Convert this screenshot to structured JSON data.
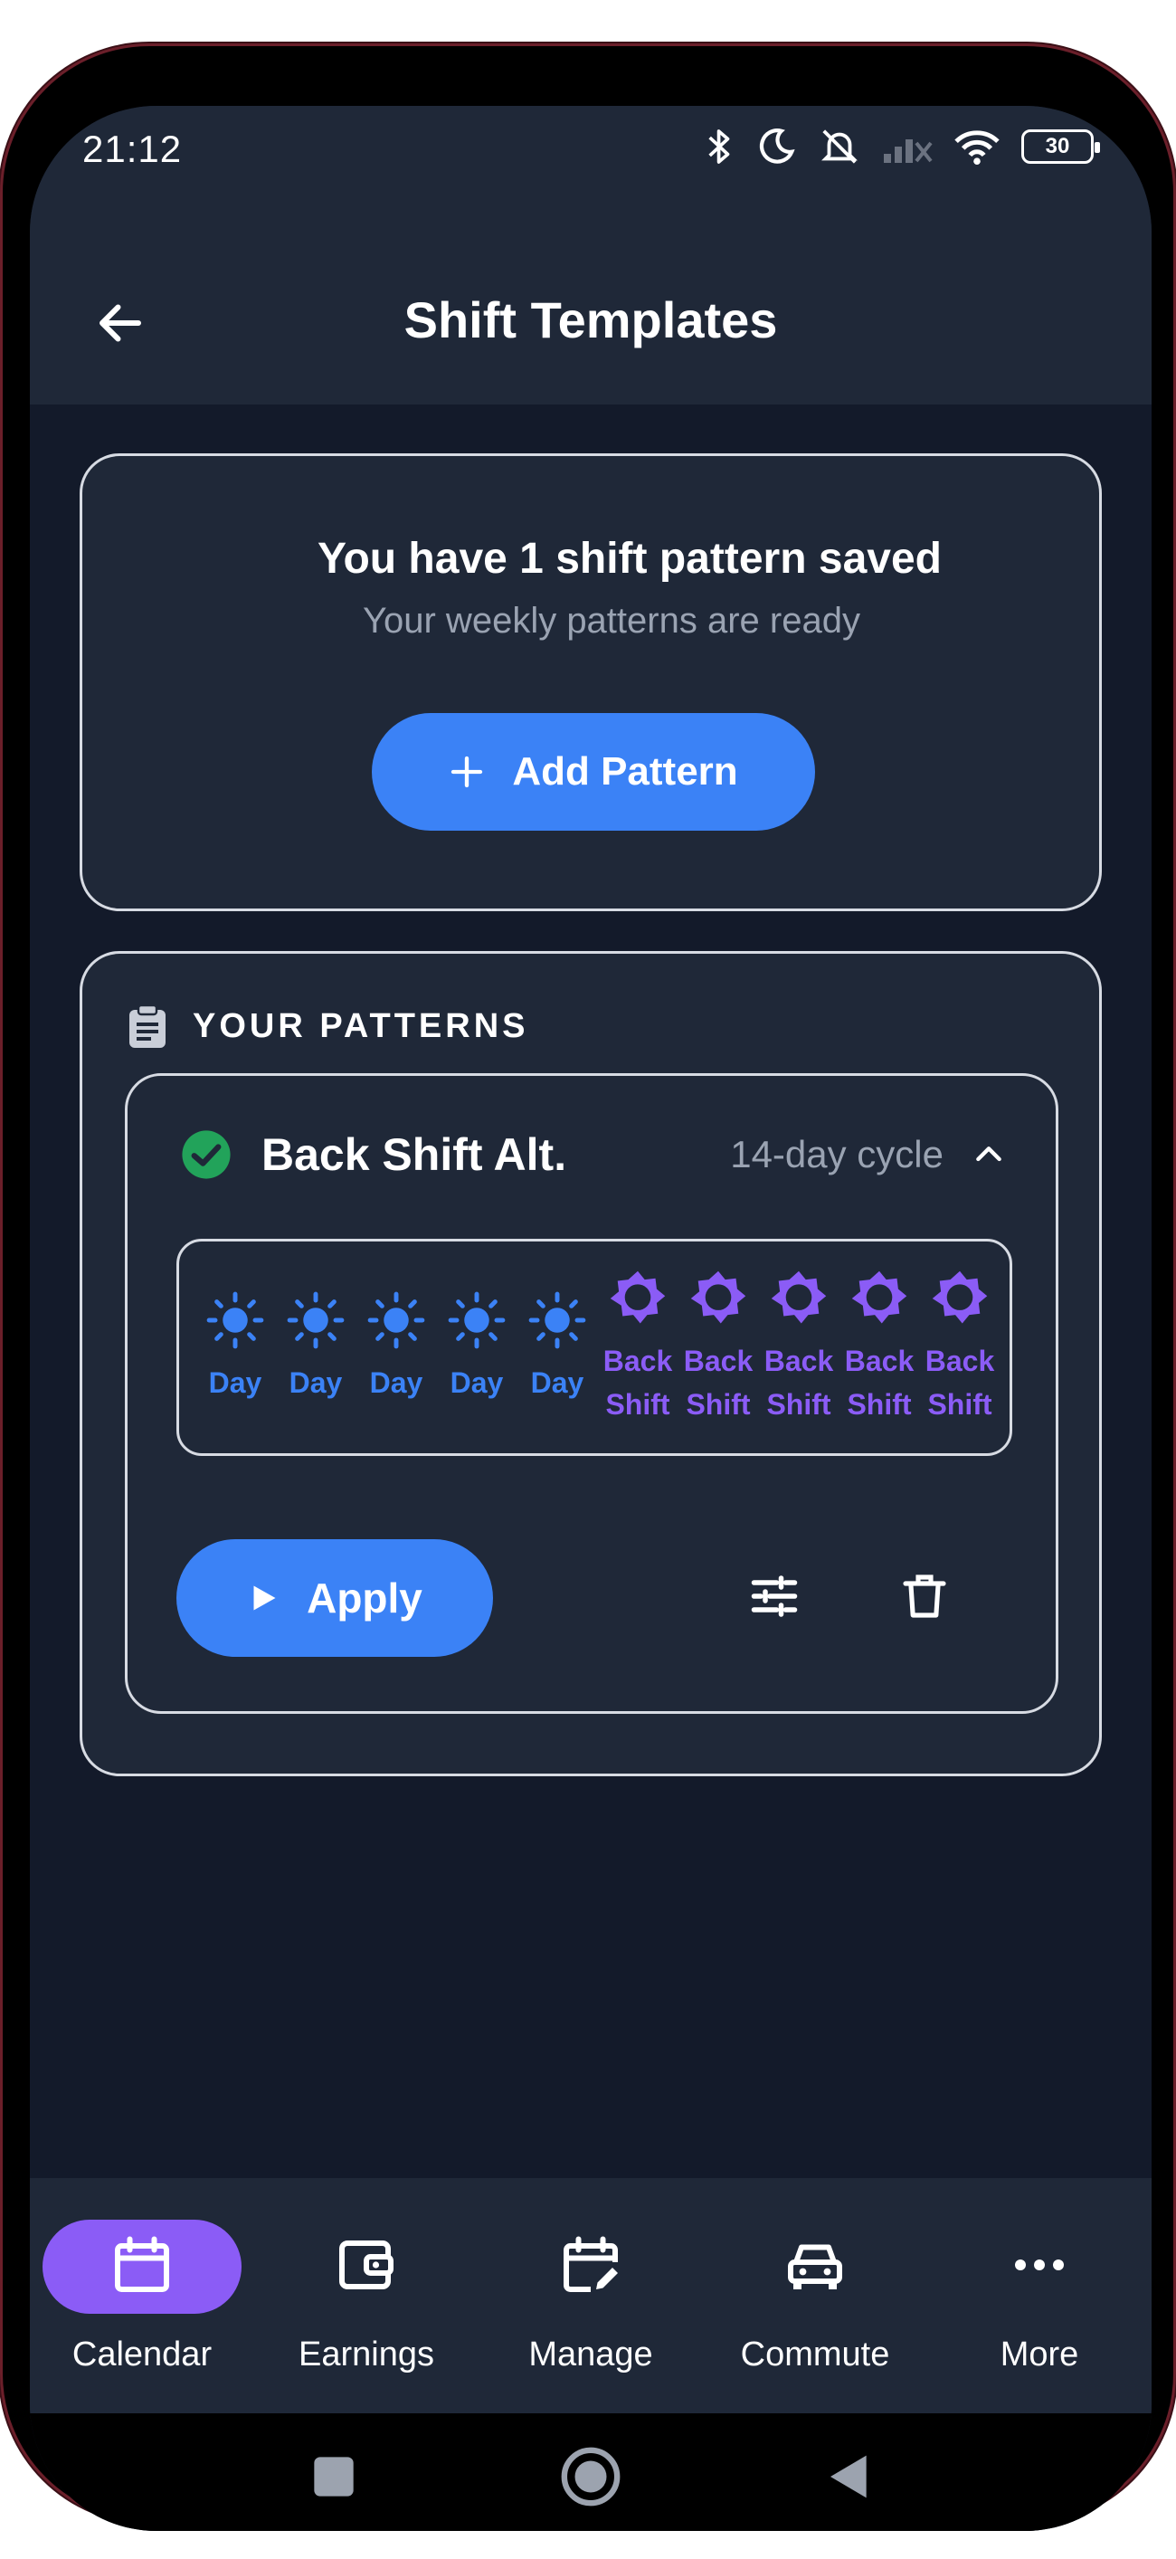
{
  "status_bar": {
    "time": "21:12",
    "battery_level": "30"
  },
  "app_bar": {
    "title": "Shift Templates"
  },
  "summary": {
    "title": "You have 1 shift pattern saved",
    "subtitle": "Your weekly patterns are ready",
    "add_button_label": "Add Pattern"
  },
  "patterns_section": {
    "header": "YOUR PATTERNS",
    "items": [
      {
        "name": "Back Shift Alt.",
        "cycle": "14-day cycle",
        "days": [
          {
            "type": "day",
            "label": "Day"
          },
          {
            "type": "day",
            "label": "Day"
          },
          {
            "type": "day",
            "label": "Day"
          },
          {
            "type": "day",
            "label": "Day"
          },
          {
            "type": "day",
            "label": "Day"
          },
          {
            "type": "back",
            "label_line1": "Back",
            "label_line2": "Shift"
          },
          {
            "type": "back",
            "label_line1": "Back",
            "label_line2": "Shift"
          },
          {
            "type": "back",
            "label_line1": "Back",
            "label_line2": "Shift"
          },
          {
            "type": "back",
            "label_line1": "Back",
            "label_line2": "Shift"
          },
          {
            "type": "back",
            "label_line1": "Back",
            "label_line2": "Shift"
          }
        ],
        "apply_label": "Apply"
      }
    ]
  },
  "bottom_nav": {
    "items": [
      {
        "label": "Calendar",
        "icon": "calendar-icon",
        "active": true
      },
      {
        "label": "Earnings",
        "icon": "wallet-icon",
        "active": false
      },
      {
        "label": "Manage",
        "icon": "edit-calendar-icon",
        "active": false
      },
      {
        "label": "Commute",
        "icon": "car-icon",
        "active": false
      },
      {
        "label": "More",
        "icon": "more-horizontal-icon",
        "active": false
      }
    ]
  },
  "colors": {
    "primary_blue": "#3b82f6",
    "accent_purple": "#8b5cf6",
    "success_green": "#22a35a",
    "surface": "#1f2838",
    "background": "#131a2a"
  }
}
